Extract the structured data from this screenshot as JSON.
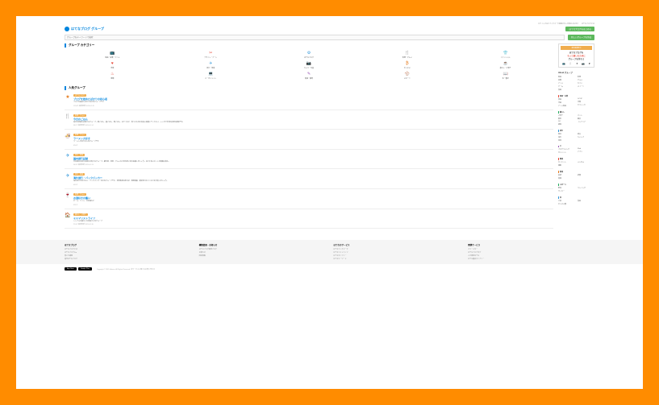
{
  "topbar": {
    "login": "ログインするとブックマーク登録ボタンが表示されます",
    "hatena": "はてなブログとは"
  },
  "header": {
    "brand": "はてなブログ グループ",
    "btn": "はてなブログをはじめる"
  },
  "search": {
    "placeholder": "グループをキーワードで検索",
    "btn": "新しいグループを作成"
  },
  "catSection": "グループ カテゴリー",
  "categories": [
    {
      "icon": "📺",
      "color": "red",
      "label": "映画・音楽・アニメ"
    },
    {
      "icon": "✂",
      "color": "red",
      "label": "デザイン・アート"
    },
    {
      "icon": "⚙",
      "color": "blue",
      "label": "はてなブログ"
    },
    {
      "icon": "🍴",
      "color": "green",
      "label": "料理・グルメ"
    },
    {
      "icon": "👕",
      "color": "orange",
      "label": "ファッション"
    },
    {
      "icon": "♥",
      "color": "red",
      "label": "恋愛"
    },
    {
      "icon": "✈",
      "color": "blue",
      "label": "旅行・地域"
    },
    {
      "icon": "📷",
      "color": "purple",
      "label": "カメラ・写真"
    },
    {
      "icon": "₿",
      "color": "orange",
      "label": "ビジネス"
    },
    {
      "icon": "☕",
      "color": "green",
      "label": "暮らし・子育て"
    },
    {
      "icon": "♨",
      "color": "red",
      "label": "健康"
    },
    {
      "icon": "💻",
      "color": "blue",
      "label": "IT・ガジェット"
    },
    {
      "icon": "✎",
      "color": "purple",
      "label": "勉強・教育"
    },
    {
      "icon": "⚾",
      "color": "green",
      "label": "スポーツ"
    },
    {
      "icon": "📖",
      "color": "orange",
      "label": "本・書評"
    }
  ],
  "popSection": "人気グループ",
  "groups": [
    {
      "icon": "★",
      "color": "orange",
      "tag": "はてなブログ",
      "name": "ブログを始めたばかりの初心者",
      "desc": "ブログを始めたばかりの方のグループです",
      "meta": "1234人 最終更新 2025-01-15"
    },
    {
      "icon": "🍴",
      "color": "red",
      "tag": "料理・グルメ",
      "name": "今日のごはん",
      "desc": "毎日の食事を記録するグループ。朝ごはん、昼ごはん、晩ごはん、おやつなど、食べたものを自由に投稿してください。レシピや外食の記録も歓迎です。",
      "meta": "987人 最終更新 2025-01-14"
    },
    {
      "icon": "🍜",
      "color": "red",
      "tag": "料理・グルメ",
      "name": "ラーメン大好き",
      "desc": "ラーメンが好きな人のグループです",
      "meta": "654人"
    },
    {
      "icon": "✈",
      "color": "blue",
      "tag": "旅行・地域",
      "name": "国内旅行記録",
      "desc": "日本国内の旅行記録を共有するグループ。観光地、温泉、グルメなど旅の思い出を投稿しましょう。おすすめスポットの情報交換も。",
      "meta": "543人 最終更新 2025-01-13"
    },
    {
      "icon": "✈",
      "color": "blue",
      "tag": "旅行・地域",
      "name": "海外旅行・バックパッカー",
      "desc": "海外旅行が好きな人、バックパッカーの方のグループです。世界各地の旅行記、現地情報、格安旅行のコツなどを共有しましょう。",
      "meta": "432人"
    },
    {
      "icon": "🍷",
      "color": "red",
      "tag": "料理・グルメ",
      "name": "お酒好きの集い",
      "desc": "ビール、ワイン、日本酒など",
      "meta": "321人"
    },
    {
      "icon": "🏠",
      "color": "blue",
      "tag": "暮らし・子育て",
      "name": "ミニマリストライフ",
      "desc": "シンプルな暮らしを目指す人のグループ",
      "meta": "210人 最終更新 2025-01-10"
    }
  ],
  "promo": {
    "tag": "参加者募集中",
    "line1": "はてなブログを",
    "line2": "もっと楽しむために",
    "line3": "グループを作ろう"
  },
  "sideTitle": "About グループ",
  "sideCols": [
    [
      "映画",
      "音楽",
      "アニメ",
      "ゲーム",
      "漫画"
    ],
    [
      "料理",
      "グルメ",
      "カフェ",
      "スイーツ"
    ]
  ],
  "sideSecs": [
    {
      "title": "映画・音楽",
      "color": "red",
      "items": [
        [
          "邦画",
          "洋画",
          "アニメ映画"
        ],
        [
          "J-POP",
          "洋楽",
          "クラシック"
        ]
      ]
    },
    {
      "title": "暮らし",
      "color": "green",
      "items": [
        [
          "子育て",
          "節約",
          "DIY",
          "掃除"
        ],
        [
          "ペット",
          "園芸",
          "インテリア"
        ]
      ]
    },
    {
      "title": "旅行",
      "color": "blue",
      "items": [
        [
          "国内",
          "海外",
          "温泉"
        ],
        [
          "登山",
          "キャンプ"
        ]
      ]
    },
    {
      "title": "IT",
      "color": "purple",
      "items": [
        [
          "プログラミング",
          "ガジェット"
        ],
        [
          "Web",
          "アプリ"
        ]
      ]
    },
    {
      "title": "健康",
      "color": "red",
      "items": [
        [
          "ダイエット",
          "運動"
        ],
        [
          "メンタル"
        ]
      ]
    },
    {
      "title": "勉強",
      "color": "orange",
      "items": [
        [
          "英語",
          "資格"
        ],
        [
          "読書"
        ]
      ]
    },
    {
      "title": "スポーツ",
      "color": "green",
      "items": [
        [
          "野球",
          "サッカー"
        ],
        [
          "ランニング"
        ]
      ]
    },
    {
      "title": "本",
      "color": "blue",
      "items": [
        [
          "小説",
          "ビジネス書"
        ],
        [
          "漫画"
        ]
      ]
    }
  ],
  "footer": [
    {
      "h": "はてなブログ",
      "links": [
        "はてなブログとは",
        "はてなブログPro",
        "使い方講座",
        "週刊はてなブログ"
      ]
    },
    {
      "h": "機能変更・お知らせ",
      "links": [
        "はてなブログ開発ブログ",
        "お知らせ",
        "障害情報"
      ]
    },
    {
      "h": "はてなのサービス",
      "links": [
        "はてなブックマーク",
        "はてなフォトライフ",
        "はてなダイアリー",
        "はてなキーワード"
      ]
    },
    {
      "h": "関連サービス",
      "links": [
        "カラースター",
        "はてなブログタグ",
        "人力検索はてな",
        "はてな匿名ダイアリー"
      ]
    }
  ],
  "badges": {
    "app": "App Store",
    "play": "Google Play",
    "copy": "Copyright © 2025 Hatena. All Rights Reserved. 本サービスに関するお問い合わせ"
  }
}
